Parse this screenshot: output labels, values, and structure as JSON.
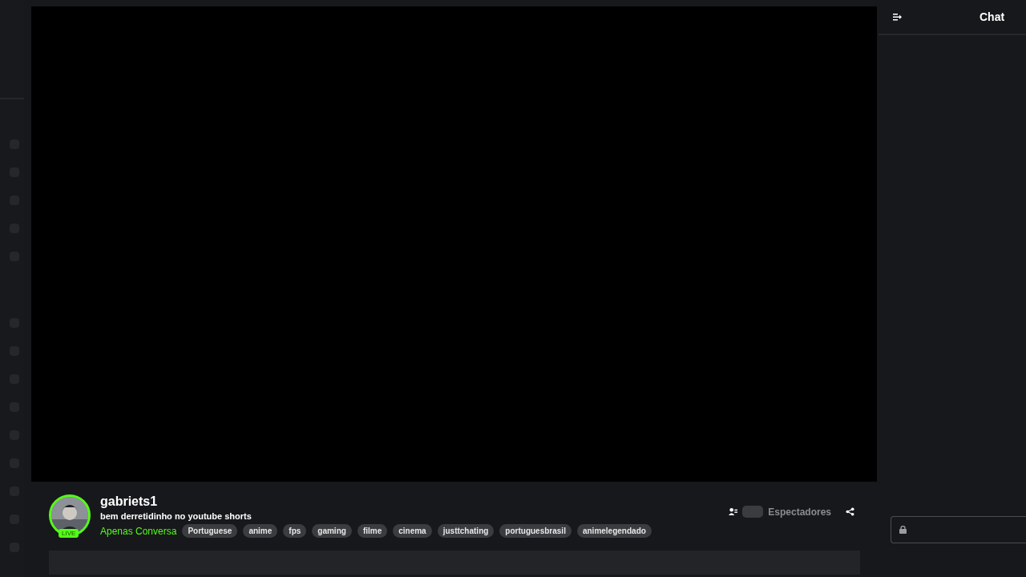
{
  "channel": {
    "name": "gabriets1",
    "live_badge": "LIVE",
    "title": "bem derretidinho no youtube shorts",
    "category": "Apenas Conversa",
    "tags": [
      "Portuguese",
      "anime",
      "fps",
      "gaming",
      "filme",
      "cinema",
      "justtchating",
      "portuguesbrasil",
      "animelegendado"
    ]
  },
  "viewers": {
    "label": "Espectadores"
  },
  "chat": {
    "title": "Chat"
  }
}
